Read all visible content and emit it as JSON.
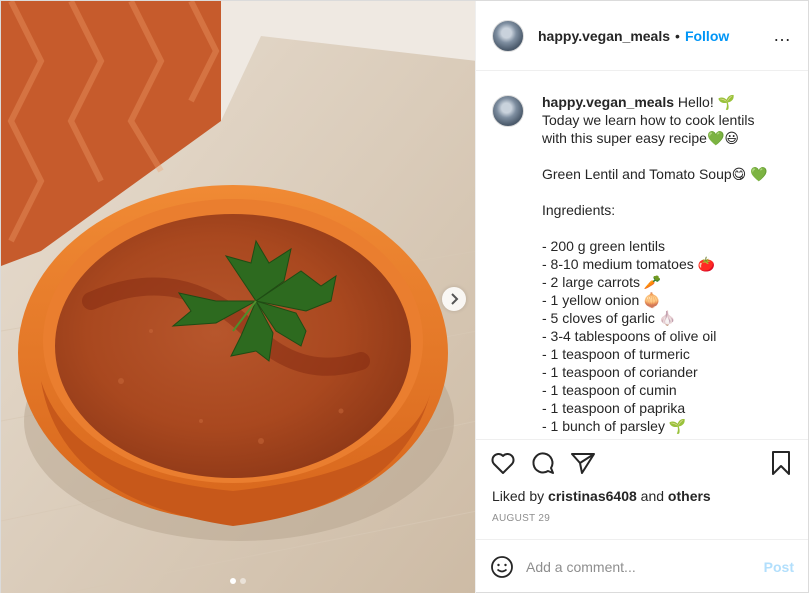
{
  "post": {
    "username": "happy.vegan_meals",
    "separator": "•",
    "follow_label": "Follow",
    "more_icon": "…",
    "caption_lines": [
      "Hello! 🌱",
      "Today we learn how to cook lentils",
      "with this super easy recipe💚😃",
      "",
      "Green Lentil and Tomato Soup😋 💚",
      "",
      "Ingredients:",
      "",
      "- 200 g green lentils",
      "- 8-10 medium tomatoes 🍅",
      "- 2 large carrots 🥕",
      "- 1 yellow onion 🧅",
      "- 5 cloves of garlic 🧄",
      "- 3-4 tablespoons of olive oil",
      "- 1 teaspoon of turmeric",
      "- 1 teaspoon of coriander",
      "- 1 teaspoon of cumin",
      "- 1 teaspoon of paprika",
      "- 1 bunch of parsley 🌱"
    ],
    "likes_prefix": "Liked by ",
    "likes_user": "cristinas6408",
    "likes_and": " and ",
    "likes_others": "others",
    "date": "AUGUST 29",
    "comment_placeholder": "Add a comment...",
    "post_label": "Post"
  },
  "carousel": {
    "slide_index": 1,
    "slide_count": 2
  },
  "colors": {
    "link": "#0095f6",
    "post_disabled": "#b2dffc",
    "muted": "#8e8e8e"
  }
}
